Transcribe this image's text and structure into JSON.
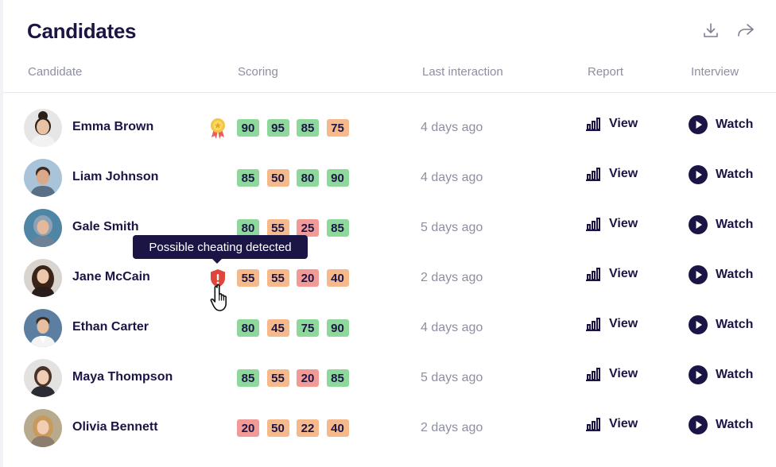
{
  "page": {
    "title": "Candidates"
  },
  "toolbar": {
    "download_icon": "download-icon",
    "share_icon": "share-icon"
  },
  "table": {
    "columns": [
      "Candidate",
      "Scoring",
      "Last interaction",
      "Report",
      "Interview"
    ],
    "report_label": "View",
    "interview_label": "Watch",
    "rows": [
      {
        "name": "Emma Brown",
        "badge": "award-ribbon-icon",
        "scores": [
          90,
          95,
          85,
          75
        ],
        "score_colors": [
          "green",
          "green",
          "green",
          "orange"
        ],
        "last_interaction": "4 days ago"
      },
      {
        "name": "Liam Johnson",
        "badge": "",
        "scores": [
          85,
          50,
          80,
          90
        ],
        "score_colors": [
          "green",
          "orange",
          "green",
          "green"
        ],
        "last_interaction": "4 days ago"
      },
      {
        "name": "Gale Smith",
        "badge": "",
        "scores": [
          80,
          55,
          25,
          85
        ],
        "score_colors": [
          "green",
          "orange",
          "red",
          "green"
        ],
        "last_interaction": "5 days ago"
      },
      {
        "name": "Jane McCain",
        "badge": "warning-shield-icon",
        "scores": [
          55,
          55,
          20,
          40
        ],
        "score_colors": [
          "orange",
          "orange",
          "red",
          "orange"
        ],
        "last_interaction": "2 days ago"
      },
      {
        "name": "Ethan Carter",
        "badge": "",
        "scores": [
          80,
          45,
          75,
          90
        ],
        "score_colors": [
          "green",
          "orange",
          "green",
          "green"
        ],
        "last_interaction": "4 days ago"
      },
      {
        "name": "Maya Thompson",
        "badge": "",
        "scores": [
          85,
          55,
          20,
          85
        ],
        "score_colors": [
          "green",
          "orange",
          "red",
          "green"
        ],
        "last_interaction": "5 days ago"
      },
      {
        "name": "Olivia Bennett",
        "badge": "",
        "scores": [
          20,
          50,
          22,
          40
        ],
        "score_colors": [
          "red",
          "orange",
          "orange",
          "orange"
        ],
        "last_interaction": "2 days ago"
      }
    ]
  },
  "tooltip": {
    "text": "Possible cheating detected"
  },
  "colors": {
    "text_primary": "#1b1546",
    "text_secondary": "#8d8fa1",
    "score_green": "#8fd89c",
    "score_orange": "#f6b98c",
    "score_red": "#f19a96",
    "warning_red": "#e0453c"
  }
}
